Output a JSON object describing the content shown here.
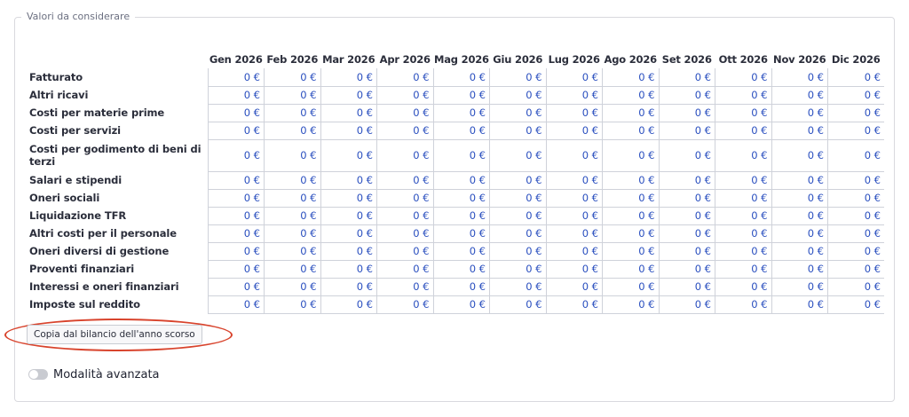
{
  "fieldset": {
    "legend": "Valori da considerare"
  },
  "table": {
    "months": [
      "Gen 2026",
      "Feb 2026",
      "Mar 2026",
      "Apr 2026",
      "Mag 2026",
      "Giu 2026",
      "Lug 2026",
      "Ago 2026",
      "Set 2026",
      "Ott 2026",
      "Nov 2026",
      "Dic 2026"
    ],
    "rows": [
      {
        "label": "Fatturato",
        "values": [
          "0 €",
          "0 €",
          "0 €",
          "0 €",
          "0 €",
          "0 €",
          "0 €",
          "0 €",
          "0 €",
          "0 €",
          "0 €",
          "0 €"
        ]
      },
      {
        "label": "Altri ricavi",
        "values": [
          "0 €",
          "0 €",
          "0 €",
          "0 €",
          "0 €",
          "0 €",
          "0 €",
          "0 €",
          "0 €",
          "0 €",
          "0 €",
          "0 €"
        ]
      },
      {
        "label": "Costi per materie prime",
        "values": [
          "0 €",
          "0 €",
          "0 €",
          "0 €",
          "0 €",
          "0 €",
          "0 €",
          "0 €",
          "0 €",
          "0 €",
          "0 €",
          "0 €"
        ]
      },
      {
        "label": "Costi per servizi",
        "values": [
          "0 €",
          "0 €",
          "0 €",
          "0 €",
          "0 €",
          "0 €",
          "0 €",
          "0 €",
          "0 €",
          "0 €",
          "0 €",
          "0 €"
        ]
      },
      {
        "label": "Costi per godimento di beni di terzi",
        "values": [
          "0 €",
          "0 €",
          "0 €",
          "0 €",
          "0 €",
          "0 €",
          "0 €",
          "0 €",
          "0 €",
          "0 €",
          "0 €",
          "0 €"
        ]
      },
      {
        "label": "Salari e stipendi",
        "values": [
          "0 €",
          "0 €",
          "0 €",
          "0 €",
          "0 €",
          "0 €",
          "0 €",
          "0 €",
          "0 €",
          "0 €",
          "0 €",
          "0 €"
        ]
      },
      {
        "label": "Oneri sociali",
        "values": [
          "0 €",
          "0 €",
          "0 €",
          "0 €",
          "0 €",
          "0 €",
          "0 €",
          "0 €",
          "0 €",
          "0 €",
          "0 €",
          "0 €"
        ]
      },
      {
        "label": "Liquidazione TFR",
        "values": [
          "0 €",
          "0 €",
          "0 €",
          "0 €",
          "0 €",
          "0 €",
          "0 €",
          "0 €",
          "0 €",
          "0 €",
          "0 €",
          "0 €"
        ]
      },
      {
        "label": "Altri costi per il personale",
        "values": [
          "0 €",
          "0 €",
          "0 €",
          "0 €",
          "0 €",
          "0 €",
          "0 €",
          "0 €",
          "0 €",
          "0 €",
          "0 €",
          "0 €"
        ]
      },
      {
        "label": "Oneri diversi di gestione",
        "values": [
          "0 €",
          "0 €",
          "0 €",
          "0 €",
          "0 €",
          "0 €",
          "0 €",
          "0 €",
          "0 €",
          "0 €",
          "0 €",
          "0 €"
        ]
      },
      {
        "label": "Proventi finanziari",
        "values": [
          "0 €",
          "0 €",
          "0 €",
          "0 €",
          "0 €",
          "0 €",
          "0 €",
          "0 €",
          "0 €",
          "0 €",
          "0 €",
          "0 €"
        ]
      },
      {
        "label": "Interessi e oneri finanziari",
        "values": [
          "0 €",
          "0 €",
          "0 €",
          "0 €",
          "0 €",
          "0 €",
          "0 €",
          "0 €",
          "0 €",
          "0 €",
          "0 €",
          "0 €"
        ]
      },
      {
        "label": "Imposte sul reddito",
        "values": [
          "0 €",
          "0 €",
          "0 €",
          "0 €",
          "0 €",
          "0 €",
          "0 €",
          "0 €",
          "0 €",
          "0 €",
          "0 €",
          "0 €"
        ]
      }
    ]
  },
  "copy_button": {
    "label": "Copia dal bilancio dell'anno scorso"
  },
  "advanced_toggle": {
    "label": "Modalità avanzata",
    "enabled": false
  },
  "colors": {
    "value_text": "#2a4fbf",
    "highlight_ring": "#d8432c",
    "toggle_off": "#c9cbd1"
  }
}
